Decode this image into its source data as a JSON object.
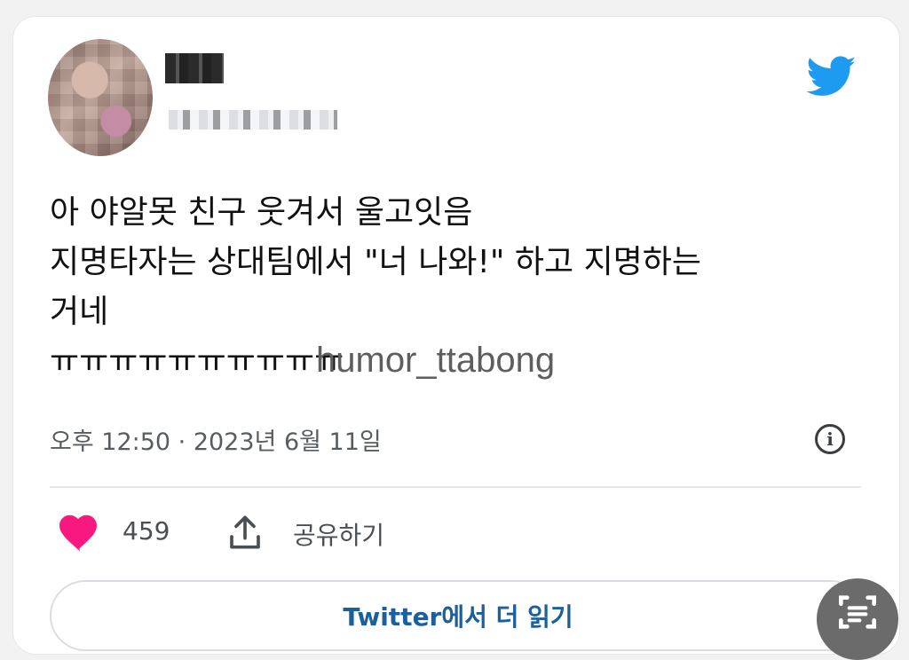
{
  "tweet": {
    "lines": [
      "아 야알못 친구 웃겨서 울고잇음",
      "지명타자는 상대팀에서 \"너 나와!\" 하고 지명하는",
      "거네",
      "ㅠㅠㅠㅠㅠㅠㅠㅠㅠㅠ"
    ],
    "timestamp": "오후 12:50 · 2023년 6월 11일"
  },
  "watermark": "humor_ttabong",
  "actions": {
    "like_count": "459",
    "share_label": "공유하기"
  },
  "read_more_label": "Twitter에서 더 읽기",
  "icons": {
    "brand": "twitter-bird-icon",
    "info": "info-icon",
    "like": "heart-icon",
    "share": "share-upload-icon",
    "overlay": "scan-text-icon"
  },
  "colors": {
    "twitter_blue": "#1D9BF0",
    "heart": "#F91880",
    "link": "#1c5f9a"
  }
}
